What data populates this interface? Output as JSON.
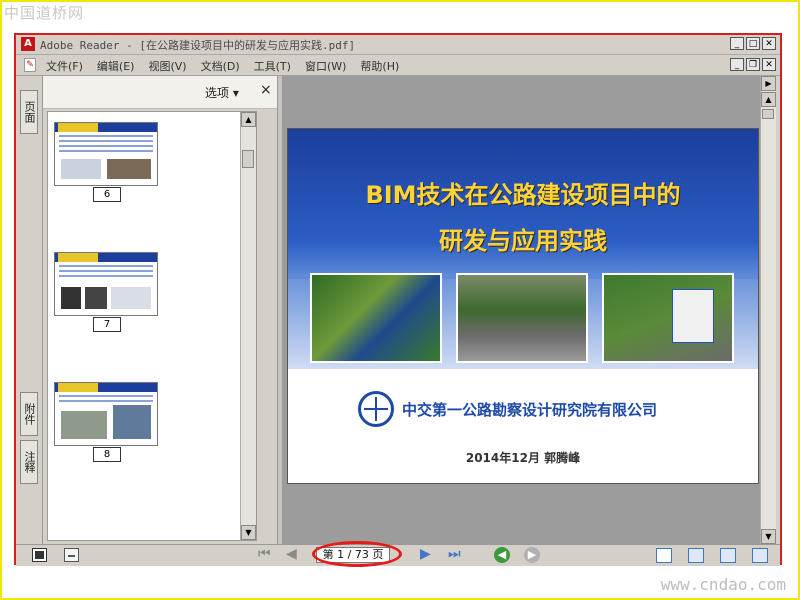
{
  "watermarks": {
    "top_left": "中国道桥网",
    "bottom_right": "www.cndao.com"
  },
  "window": {
    "title": "Adobe Reader - [在公路建设项目中的研发与应用实践.pdf]",
    "app_icon": "adobe-reader-icon"
  },
  "menu": {
    "items": [
      "文件(F)",
      "编辑(E)",
      "视图(V)",
      "文档(D)",
      "工具(T)",
      "窗口(W)",
      "帮助(H)"
    ]
  },
  "side_tabs": {
    "pages": "页面",
    "attachments": "附件",
    "comments": "注释"
  },
  "nav_panel": {
    "options_label": "选项",
    "close_label": "×",
    "thumbnails": [
      {
        "page": "6"
      },
      {
        "page": "7"
      },
      {
        "page": "8"
      }
    ]
  },
  "slide": {
    "title_line1": "BIM技术在公路建设项目中的",
    "title_line2": "研发与应用实践",
    "company": "中交第一公路勘察设计研究院有限公司",
    "footer": "2014年12月 郭腾峰"
  },
  "bottom_toolbar": {
    "page_indicator": "第 1 / 73 页",
    "current_page": 1,
    "total_pages": 73
  },
  "colors": {
    "highlight_ring": "#e41b1b",
    "frame": "#f0e800",
    "title_text": "#ffd43a",
    "company_text": "#1d4aa8"
  }
}
